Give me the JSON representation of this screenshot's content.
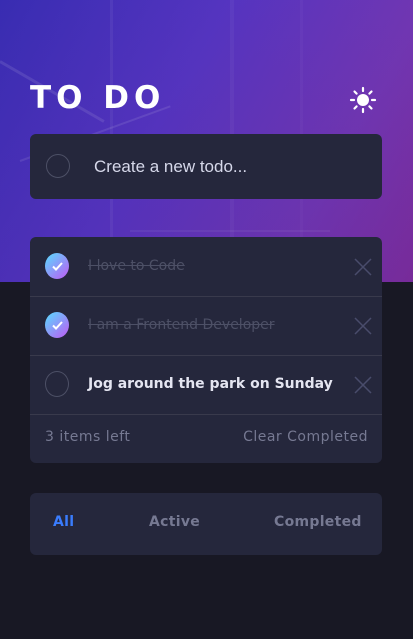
{
  "header": {
    "title": "TO DO",
    "theme_toggle_icon": "sun-icon"
  },
  "new_todo": {
    "placeholder": "Create a new todo...",
    "value": ""
  },
  "todos": [
    {
      "text": "I love to Code",
      "completed": true
    },
    {
      "text": "I am a Frontend Developer",
      "completed": true
    },
    {
      "text": "Jog around the park on Sunday",
      "completed": false
    }
  ],
  "list_footer": {
    "items_left": "3 items left",
    "clear_label": "Clear Completed"
  },
  "filters": {
    "all": "All",
    "active": "Active",
    "completed": "Completed",
    "selected": "All"
  },
  "colors": {
    "background": "#181824",
    "card": "#25273c",
    "accent": "#3a7cfd",
    "check_gradient_start": "#57ddff",
    "check_gradient_end": "#c058f3",
    "muted_text": "#767992",
    "completed_text": "#4d5066"
  }
}
